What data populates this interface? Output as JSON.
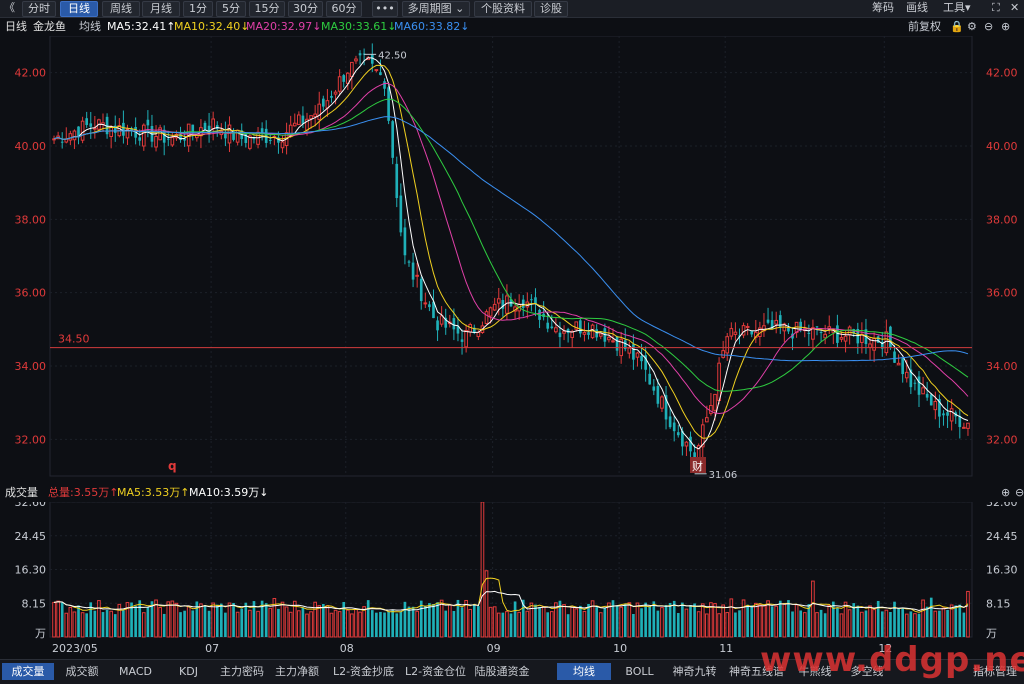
{
  "toolbar": {
    "back": "《",
    "tabs": [
      "分时",
      "日线",
      "周线",
      "月线",
      "1分",
      "5分",
      "15分",
      "30分",
      "60分",
      "•••",
      "多周期图 ⌄",
      "个股资料",
      "诊股"
    ],
    "active_tab": 1,
    "right": [
      "筹码",
      "画线",
      "工具▾"
    ]
  },
  "legend": {
    "period": "日线",
    "name": "金龙鱼",
    "avg": "均线",
    "ma5": "MA5:32.41↑",
    "ma10": "MA10:32.40↓",
    "ma20": "MA20:32.97↓",
    "ma30": "MA30:33.61↓",
    "ma60": "MA60:33.82↓",
    "fq": "前复权"
  },
  "vol_legend": {
    "title": "成交量",
    "total": "总量:3.55万↑",
    "ma5": "MA5:3.53万↑",
    "ma10": "MA10:3.59万↓"
  },
  "price_axis": [
    "42.00",
    "40.00",
    "38.00",
    "36.00",
    "34.00",
    "32.00"
  ],
  "vol_axis": [
    "32.60",
    "24.45",
    "16.30",
    "8.15",
    "万"
  ],
  "x_axis": [
    "2023/05",
    "07",
    "08",
    "09",
    "10",
    "11",
    "12"
  ],
  "annotations": {
    "high": "42.50",
    "low": "31.06",
    "hline": "34.50",
    "q_marker": "q",
    "cai_marker": "财"
  },
  "bottom_tabs": [
    "成交量",
    "成交额",
    "MACD",
    "KDJ",
    "主力密码",
    "主力净额",
    "L2-资金抄底",
    "L2-资金仓位",
    "陆股通资金"
  ],
  "bottom_right_tabs": [
    "均线",
    "BOLL",
    "神奇九转",
    "神奇五线谱",
    "牛熊线",
    "多空线"
  ],
  "bottom_last": "指标管理",
  "watermark": "www.ddgp.net",
  "colors": {
    "up": "#e03a3a",
    "down": "#1fb0b8",
    "ma5": "#ffffff",
    "ma10": "#f0d020",
    "ma20": "#e040a8",
    "ma30": "#2ecc40",
    "ma60": "#3a8ff0",
    "hline": "#d23c3c"
  },
  "chart_data": {
    "type": "candlestick",
    "title": "金龙鱼 日线",
    "price_ylim": [
      31.0,
      43.0
    ],
    "volume_ylim": [
      0,
      32.6
    ],
    "volume_unit": "万",
    "segments": [
      {
        "from": "2023/05",
        "to": "07",
        "days": 39,
        "start": 40.2,
        "end": 40.6,
        "path": [
          [
            0,
            40.2
          ],
          [
            0.25,
            40.6
          ],
          [
            0.5,
            40.4
          ],
          [
            0.75,
            40.2
          ],
          [
            1,
            40.6
          ]
        ]
      },
      {
        "from": "07",
        "to": "08",
        "days": 33,
        "start": 40.6,
        "end": 42.1,
        "path": [
          [
            0,
            40.6
          ],
          [
            0.2,
            40.2
          ],
          [
            0.5,
            40.3
          ],
          [
            0.8,
            41.0
          ],
          [
            1,
            42.1
          ]
        ]
      },
      {
        "from": "08",
        "to": "09",
        "days": 36,
        "start": 42.1,
        "end": 35.6,
        "path": [
          [
            0,
            42.1
          ],
          [
            0.12,
            42.3
          ],
          [
            0.25,
            41.8
          ],
          [
            0.38,
            37.0
          ],
          [
            0.6,
            35.2
          ],
          [
            0.8,
            34.8
          ],
          [
            1,
            35.6
          ]
        ]
      },
      {
        "from": "09",
        "to": "10",
        "days": 31,
        "start": 35.6,
        "end": 34.6,
        "path": [
          [
            0,
            35.6
          ],
          [
            0.2,
            35.9
          ],
          [
            0.5,
            35.0
          ],
          [
            0.75,
            35.1
          ],
          [
            1,
            34.6
          ]
        ]
      },
      {
        "from": "10",
        "to": "11",
        "days": 26,
        "start": 34.6,
        "end": 34.8,
        "path": [
          [
            0,
            34.6
          ],
          [
            0.2,
            34.0
          ],
          [
            0.45,
            32.6
          ],
          [
            0.7,
            31.5
          ],
          [
            0.85,
            33.0
          ],
          [
            1,
            34.8
          ]
        ]
      },
      {
        "from": "11",
        "to": "12",
        "days": 39,
        "start": 34.8,
        "end": 34.7,
        "path": [
          [
            0,
            34.8
          ],
          [
            0.3,
            35.0
          ],
          [
            0.6,
            34.9
          ],
          [
            1,
            34.7
          ]
        ]
      },
      {
        "from": "12",
        "to": "end",
        "days": 21,
        "start": 34.7,
        "end": 32.4,
        "path": [
          [
            0,
            34.7
          ],
          [
            0.3,
            33.5
          ],
          [
            0.6,
            32.8
          ],
          [
            1,
            32.4
          ]
        ]
      }
    ],
    "volume_baseline": 5.5,
    "volume_spikes": [
      [
        105,
        32.6
      ],
      [
        106,
        16.0
      ],
      [
        115,
        9.0
      ],
      [
        186,
        13.5
      ],
      [
        224,
        11.0
      ],
      [
        215,
        9.5
      ],
      [
        166,
        9.2
      ],
      [
        54,
        9.3
      ]
    ],
    "series": [
      {
        "name": "MA5",
        "value": 32.41
      },
      {
        "name": "MA10",
        "value": 32.4
      },
      {
        "name": "MA20",
        "value": 32.97
      },
      {
        "name": "MA30",
        "value": 33.61
      },
      {
        "name": "MA60",
        "value": 33.82
      }
    ],
    "high": 42.5,
    "low": 31.06,
    "reference_line": 34.5
  }
}
